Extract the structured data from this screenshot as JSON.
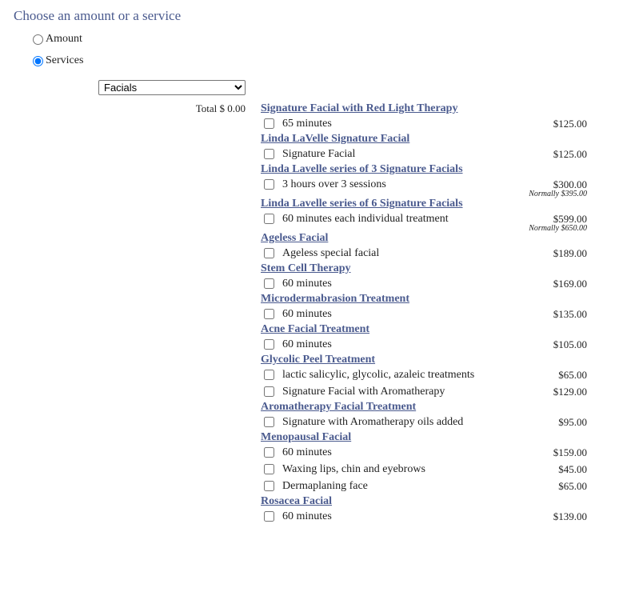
{
  "heading": "Choose an amount or a service",
  "radios": {
    "amount_label": "Amount",
    "services_label": "Services",
    "selected": "Services"
  },
  "category_select": {
    "value": "Facials"
  },
  "total": "Total $ 0.00",
  "groups": [
    {
      "title": "Signature Facial with Red Light Therapy",
      "items": [
        {
          "label": "65 minutes",
          "price": "$125.00"
        }
      ]
    },
    {
      "title": "Linda LaVelle Signature Facial",
      "items": [
        {
          "label": "Signature Facial",
          "price": "$125.00"
        }
      ]
    },
    {
      "title": "Linda Lavelle series of 3 Signature Facials",
      "items": [
        {
          "label": "3 hours over 3 sessions",
          "price": "$300.00",
          "normally": "Normally $395.00"
        }
      ]
    },
    {
      "title": "Linda Lavelle series of 6 Signature Facials",
      "items": [
        {
          "label": "60 minutes each individual treatment",
          "price": "$599.00",
          "normally": "Normally $650.00"
        }
      ]
    },
    {
      "title": "Ageless Facial",
      "items": [
        {
          "label": "Ageless special facial",
          "price": "$189.00"
        }
      ]
    },
    {
      "title": "Stem Cell Therapy",
      "items": [
        {
          "label": "60 minutes",
          "price": "$169.00"
        }
      ]
    },
    {
      "title": "Microdermabrasion Treatment",
      "items": [
        {
          "label": "60 minutes",
          "price": "$135.00"
        }
      ]
    },
    {
      "title": "Acne Facial Treatment",
      "items": [
        {
          "label": "60 minutes",
          "price": "$105.00"
        }
      ]
    },
    {
      "title": "Glycolic Peel Treatment",
      "items": [
        {
          "label": "lactic salicylic, glycolic, azaleic treatments",
          "price": "$65.00"
        },
        {
          "label": "Signature Facial with Aromatherapy",
          "price": "$129.00"
        }
      ]
    },
    {
      "title": "Aromatherapy Facial Treatment",
      "items": [
        {
          "label": "Signature with Aromatherapy oils added",
          "price": "$95.00"
        }
      ]
    },
    {
      "title": "Menopausal Facial",
      "items": [
        {
          "label": "60 minutes",
          "price": "$159.00"
        },
        {
          "label": "Waxing lips, chin and eyebrows",
          "price": "$45.00"
        },
        {
          "label": "Dermaplaning face",
          "price": "$65.00"
        }
      ]
    },
    {
      "title": "Rosacea Facial",
      "items": [
        {
          "label": "60 minutes",
          "price": "$139.00"
        }
      ]
    }
  ]
}
